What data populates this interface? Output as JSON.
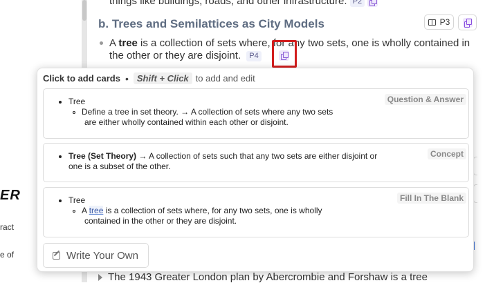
{
  "sidebar": {
    "heading_fragment": "ER",
    "text_fragment_1": "ract",
    "text_fragment_2": "e of"
  },
  "article": {
    "prev_line": "things like buildings, roads, and other infrastructure.",
    "prev_page_tag": "P2",
    "section_title": "b. Trees and Semilattices as City Models",
    "page_button_label": "P3",
    "paragraph": {
      "lead": "A ",
      "term": "tree",
      "rest": " is a collection of sets where, for any two sets, one is wholly contained in the other or they are disjoint.",
      "page_tag": "P4"
    },
    "bottom_line": "The 1943 Greater London plan by Abercrombie and Forshaw is a tree"
  },
  "popover": {
    "header": {
      "lead": "Click to add cards",
      "separator": "•",
      "shortcut": "Shift + Click",
      "tail": "to add and edit"
    },
    "cards": [
      {
        "type": "Question & Answer",
        "title": "Tree",
        "line1": "Define a tree in set theory. → A collection of sets where any two sets",
        "line2": "are either wholly contained within each other or disjoint."
      },
      {
        "type": "Concept",
        "term": "Tree (Set Theory)",
        "line1": " → A collection of sets such that any two sets are either disjoint or",
        "line2": "one is a subset of the other."
      },
      {
        "type": "Fill In The Blank",
        "title": "Tree",
        "pre": "A ",
        "blank": "tree",
        "line1": " is a collection of sets where, for any two sets, one is wholly",
        "line2": "contained in the other or they are disjoint."
      }
    ],
    "write_own_label": "Write Your Own"
  },
  "colors": {
    "highlight_box": "#d21e1e",
    "section_title": "#5f6d82",
    "copy_icon_accent": "#8a4fe0"
  },
  "icons": {
    "page_button": "book-icon",
    "copy": "copy-icon",
    "write": "edit-icon"
  }
}
